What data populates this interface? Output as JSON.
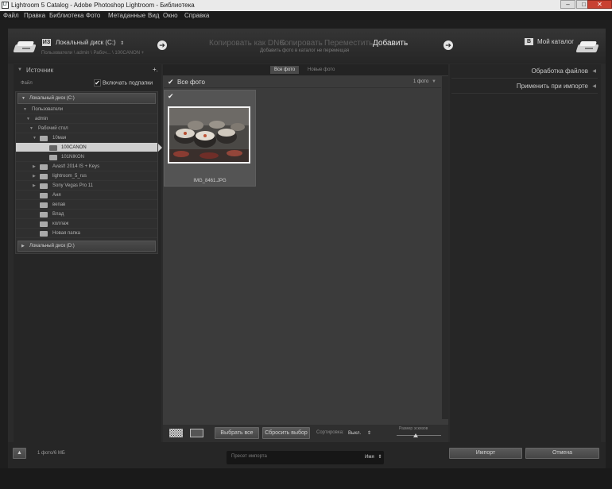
{
  "window": {
    "title": "Lightroom 5 Catalog - Adobe Photoshop Lightroom - Библиотека",
    "icon_letters": "Lr",
    "minimize": "–",
    "maximize": "□",
    "close": "✕"
  },
  "menu": [
    "Файл",
    "Правка",
    "Библиотека",
    "Фото",
    "Метаданные",
    "Вид",
    "Окно",
    "Справка"
  ],
  "header": {
    "source_badge": "ИЗ",
    "source_name": "Локальный диск (C:)",
    "source_arrow": "⇕",
    "source_path": "Пользователи \\ admin \\ Рабоч... \\ 100CANON +",
    "modes": [
      "Копировать как DNG",
      "Копировать",
      "Переместить",
      "Добавить"
    ],
    "mode_description": "Добавить фото в каталог не перемещая",
    "dest_badge": "В",
    "dest_name": "Мой каталог",
    "arrow": "➔"
  },
  "left_panel": {
    "title": "Источник",
    "add": "+.",
    "section": "Файл",
    "include_subfolders": "Включать подпапки",
    "drive_c": "Локальный диск (C:)",
    "drive_d": "Локальный диск (D:)",
    "tree": [
      "Пользователи",
      "admin",
      "Рабочий стол",
      "10мая",
      "100CANON",
      "101NIKON",
      "Avast! 2014 IS + Keys",
      "lightroom_5_rus",
      "Sony Vegas Pro 11",
      "Аня",
      "вепав",
      "Влад",
      "коллаж",
      "Новая папка"
    ]
  },
  "center": {
    "tabs": [
      "Все фото",
      "Новые фото"
    ],
    "all_photos": "Все фото",
    "count": "1 фото",
    "thumbnail": {
      "filename": "IMG_8461.JPG"
    },
    "select_all": "Выбрать все",
    "deselect": "Сбросить выбор",
    "sort_label": "Сортировка:",
    "sort_value": "Выкл.",
    "sort_arrow": "⇕",
    "thumb_size_label": "Размер эскизов"
  },
  "right_panel": {
    "file_handling": "Обработка файлов",
    "apply_on_import": "Применить при импорте"
  },
  "footer": {
    "summary": "1 фото/6 МБ",
    "preset_label": "Пресет импорта",
    "preset_value": "Имя",
    "preset_arrow": "⇕",
    "import": "Импорт",
    "cancel": "Отмена"
  },
  "colors": {
    "selected_row": "#cfcfcf",
    "accent_text": "#e8e8e8"
  }
}
